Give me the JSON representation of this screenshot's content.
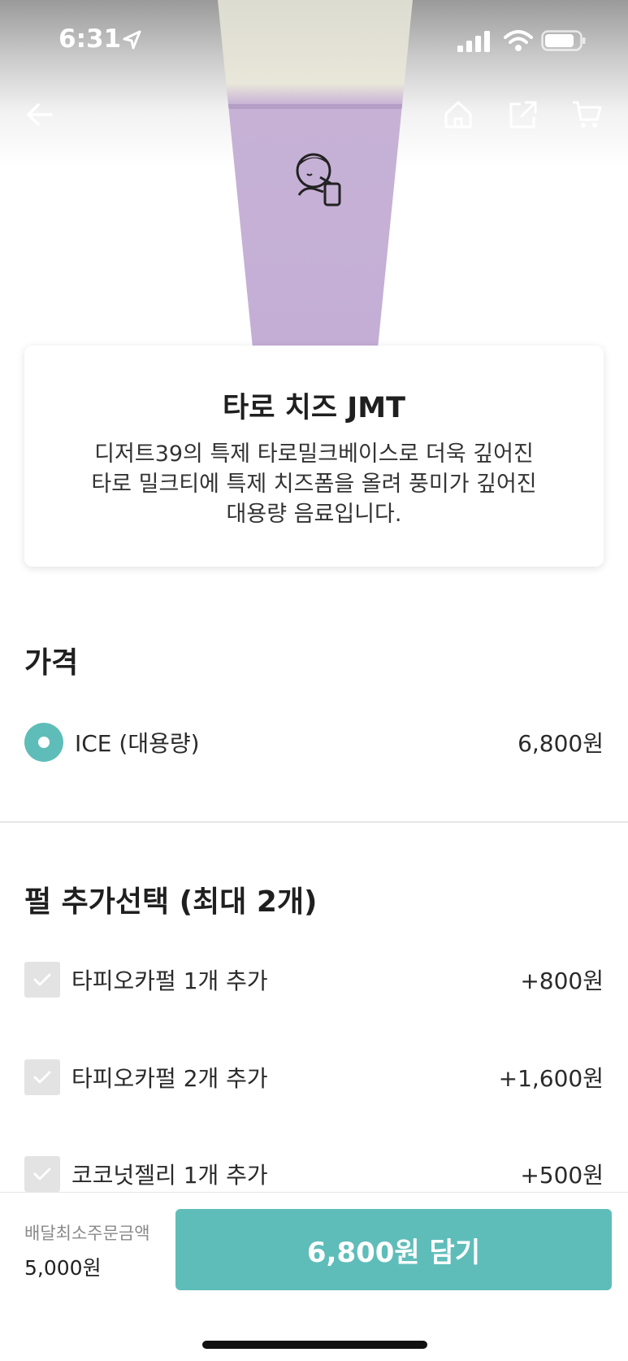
{
  "status_bar": {
    "time": "6:31"
  },
  "product": {
    "title": "타로 치즈 JMT",
    "description": "디저트39의 특제 타로밀크베이스로 더욱 깊어진\n타로 밀크티에 특제 치즈폼을 올려 풍미가 깊어진\n대용량 음료입니다."
  },
  "price_section": {
    "title": "가격",
    "options": [
      {
        "label": "ICE (대용량)",
        "price": "6,800원",
        "selected": true
      }
    ]
  },
  "pearl_section": {
    "title": "펄 추가선택 (최대 2개)",
    "options": [
      {
        "label": "타피오카펄 1개 추가",
        "price": "+800원"
      },
      {
        "label": "타피오카펄 2개 추가",
        "price": "+1,600원"
      },
      {
        "label": "코코넛젤리 1개  추가",
        "price": "+500원"
      }
    ]
  },
  "bottom_bar": {
    "min_order_label": "배달최소주문금액",
    "min_order_value": "5,000원",
    "add_button_label": "6,800원 담기"
  },
  "colors": {
    "accent": "#5fbdb9"
  },
  "icons": [
    "back-arrow-icon",
    "home-icon",
    "share-icon",
    "cart-icon",
    "location-arrow-icon",
    "signal-icon",
    "wifi-icon",
    "battery-icon",
    "check-icon"
  ]
}
